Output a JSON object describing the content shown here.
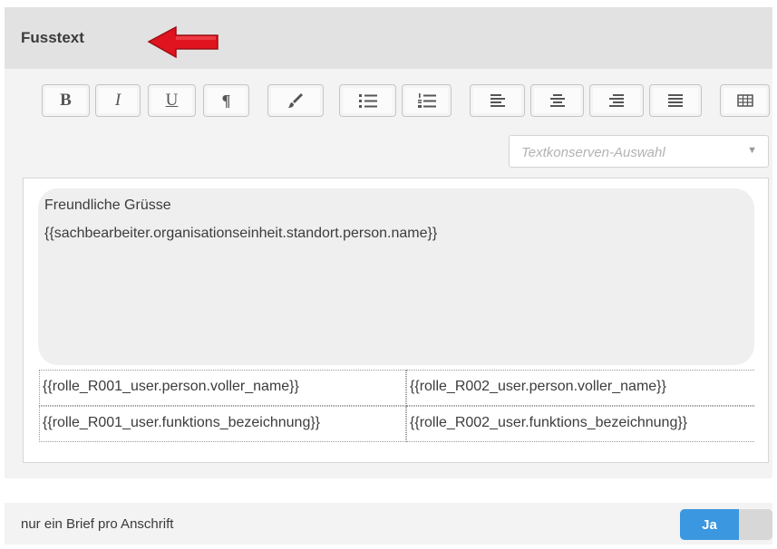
{
  "section": {
    "title": "Fusstext"
  },
  "toolbar": {
    "bold_label": "B",
    "italic_label": "I",
    "underline_label": "U",
    "paragraph_label": "¶",
    "buttons": [
      "bold",
      "italic",
      "underline",
      "paragraph",
      "brush",
      "bullet-list",
      "numbered-list",
      "align-left",
      "align-center",
      "align-right",
      "justify",
      "table"
    ]
  },
  "snippet_select": {
    "placeholder": "Textkonserven-Auswahl"
  },
  "editor": {
    "line1": "Freundliche Grüsse",
    "line2": "{{sachbearbeiter.organisationseinheit.standort.person.name}}",
    "signature_table": {
      "rows": [
        [
          "{{rolle_R001_user.person.voller_name}}",
          "{{rolle_R002_user.person.voller_name}}"
        ],
        [
          "{{rolle_R001_user.funktions_bezeichnung}}",
          "{{rolle_R002_user.funktions_bezeichnung}}"
        ]
      ]
    }
  },
  "option": {
    "label": "nur ein Brief pro Anschrift",
    "toggle_label": "Ja",
    "toggle_on": true
  },
  "colors": {
    "toggle_active": "#3a97e0",
    "arrow": "#e0141e"
  }
}
